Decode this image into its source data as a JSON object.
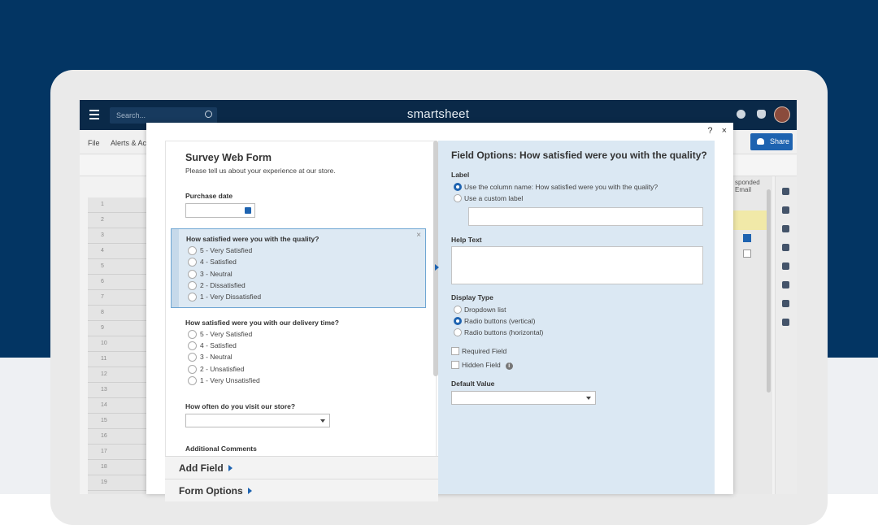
{
  "app": {
    "brand": "smartsheet",
    "search_placeholder": "Search...",
    "share_label": "Share"
  },
  "menu": {
    "file": "File",
    "alerts": "Alerts & Ac"
  },
  "sheet": {
    "row_numbers": [
      "1",
      "2",
      "3",
      "4",
      "5",
      "6",
      "7",
      "8",
      "9",
      "10",
      "11",
      "12",
      "13",
      "14",
      "15",
      "16",
      "17",
      "18",
      "19"
    ],
    "right_column_header": "sponded Email"
  },
  "modal": {
    "help": "?",
    "close": "×"
  },
  "form": {
    "title": "Survey Web Form",
    "subtitle": "Please tell us about your experience at our store.",
    "purchase_date_label": "Purchase date",
    "q1": {
      "label": "How satisfied were you with the quality?",
      "options": [
        "5 - Very Satisfied",
        "4 - Satisfied",
        "3 - Neutral",
        "2 - Dissatisfied",
        "1 - Very Dissatisfied"
      ],
      "remove": "×"
    },
    "q2": {
      "label": "How satisfied were you with our delivery time?",
      "options": [
        "5 - Very Satisfied",
        "4 - Satisfied",
        "3 - Neutral",
        "2 - Unsatisfied",
        "1 - Very Unsatisfied"
      ]
    },
    "q3_label": "How often do you visit our store?",
    "comments_label": "Additional Comments",
    "add_field": "Add Field",
    "form_options": "Form Options"
  },
  "options": {
    "title": "Field Options: How satisfied were you with the quality?",
    "label_heading": "Label",
    "use_column": "Use the column name: How satisfied were you with the quality?",
    "use_custom": "Use a custom label",
    "help_heading": "Help Text",
    "display_heading": "Display Type",
    "display_types": [
      "Dropdown list",
      "Radio buttons (vertical)",
      "Radio buttons (horizontal)"
    ],
    "required": "Required Field",
    "hidden": "Hidden Field",
    "info_glyph": "i",
    "default_heading": "Default Value"
  },
  "colors": {
    "navy": "#033563",
    "accent": "#1e63b0",
    "panel": "#dbe8f3"
  }
}
